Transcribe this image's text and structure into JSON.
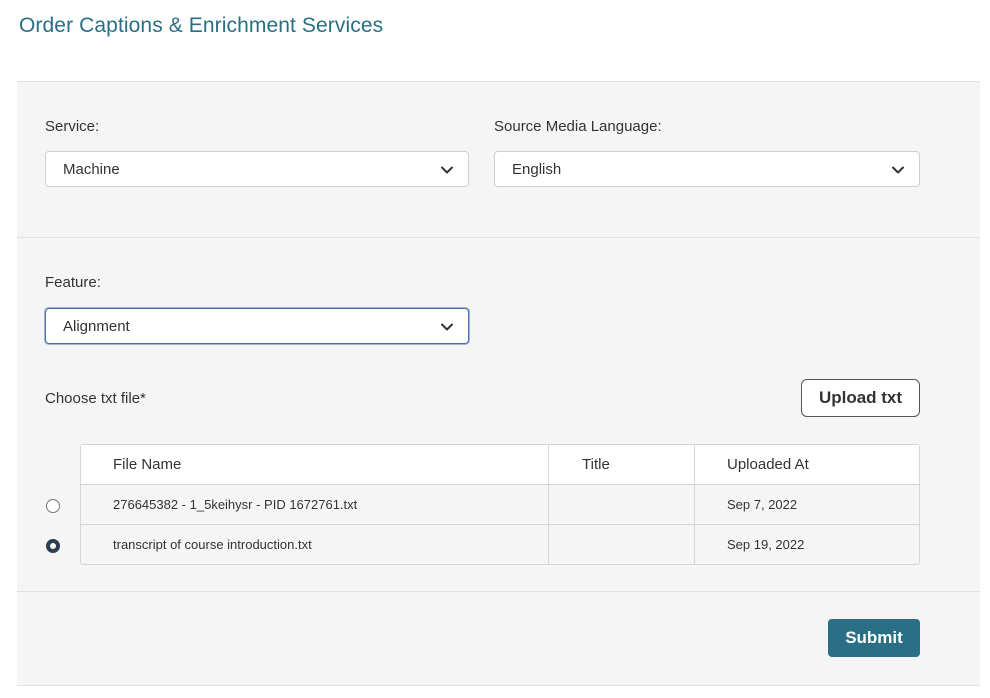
{
  "page": {
    "title": "Order Captions & Enrichment Services"
  },
  "service": {
    "label": "Service:",
    "value": "Machine"
  },
  "language": {
    "label": "Source Media Language:",
    "value": "English"
  },
  "feature": {
    "label": "Feature:",
    "value": "Alignment"
  },
  "txt_file": {
    "label": "Choose txt file*",
    "upload_label": "Upload txt",
    "columns": [
      "File Name",
      "Title",
      "Uploaded At"
    ],
    "rows": [
      {
        "file_name": "276645382 - 1_5keihysr - PID 1672761.txt",
        "title": "",
        "uploaded_at": "Sep 7, 2022",
        "selected": false
      },
      {
        "file_name": "transcript of course introduction.txt",
        "title": "",
        "uploaded_at": "Sep 19, 2022",
        "selected": true
      }
    ]
  },
  "actions": {
    "submit_label": "Submit"
  },
  "icons": {
    "select_arrow": "chevron-down-icon"
  },
  "colors": {
    "accent": "#2a6f85",
    "panel": "#f5f5f5",
    "focus": "#4a6ea9"
  }
}
